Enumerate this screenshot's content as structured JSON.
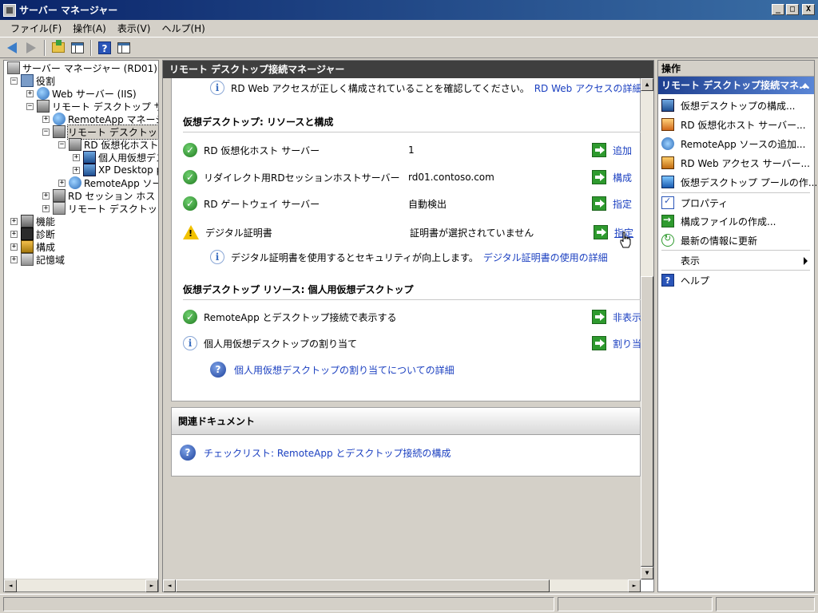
{
  "window": {
    "title": "サーバー マネージャー",
    "buttons": {
      "minimize": "_",
      "maximize": "□",
      "close": "X"
    }
  },
  "menu": [
    "ファイル(F)",
    "操作(A)",
    "表示(V)",
    "ヘルプ(H)"
  ],
  "toolbar": {
    "icons": [
      "back-arrow-icon",
      "forward-arrow-icon",
      "up-folder-icon",
      "show-hide-console-tree-icon",
      "help-icon",
      "show-hide-action-pane-icon"
    ],
    "help_label": "?"
  },
  "tree": {
    "root": "サーバー マネージャー (RD01)",
    "roles": "役割",
    "web_server": "Web サーバー (IIS)",
    "rds": "リモート デスクトップ サービス",
    "remoteapp_manager": "RemoteApp マネージャー",
    "rd_conn_manager": "リモート デスクトップ接続マネージャー",
    "rd_virt_host": "RD 仮想化ホスト サーバー",
    "personal_vd": "個人用仮想デスクトップ",
    "xp_desktop": "XP Desktop pool",
    "remoteapp_source": "RemoteApp ソース",
    "rd_session_host": "RD セッション ホストの構成",
    "rd_other": "リモート デスクトップ サービス",
    "features": "機能",
    "diagnostics": "診断",
    "configuration": "構成",
    "storage": "記憶域",
    "expand_symbol": "+",
    "collapse_symbol": "−"
  },
  "center": {
    "header": "リモート デスクトップ接続マネージャー",
    "top_info_text": "RD Web アクセスが正しく構成されていることを確認してください。",
    "top_info_link": "RD Web アクセスの詳細",
    "section1": {
      "title": "仮想デスクトップ: リソースと構成",
      "rows": [
        {
          "status": "ok",
          "label": "RD 仮想化ホスト サーバー",
          "value": "1",
          "action": "追加"
        },
        {
          "status": "ok",
          "label": "リダイレクト用RDセッションホストサーバー",
          "value": "rd01.contoso.com",
          "action": "構成"
        },
        {
          "status": "ok",
          "label": "RD ゲートウェイ サーバー",
          "value": "自動検出",
          "action": "指定"
        },
        {
          "status": "warn",
          "label": "デジタル証明書",
          "value": "証明書が選択されていません",
          "action": "指定"
        }
      ],
      "cert_info_text": "デジタル証明書を使用するとセキュリティが向上します。",
      "cert_info_link": "デジタル証明書の使用の詳細"
    },
    "section2": {
      "title": "仮想デスクトップ リソース: 個人用仮想デスクトップ",
      "rows": [
        {
          "status": "ok",
          "label": "RemoteApp とデスクトップ接続で表示する",
          "action": "非表示"
        },
        {
          "status": "info",
          "label": "個人用仮想デスクトップの割り当て",
          "action": "割り当て"
        }
      ],
      "help_link": "個人用仮想デスクトップの割り当てについての詳細"
    },
    "related": {
      "title": "関連ドキュメント",
      "link": "チェックリスト: RemoteApp とデスクトップ接続の構成"
    },
    "ok_symbol": "✓",
    "warn_symbol": "!",
    "info_symbol": "i",
    "help_symbol": "?"
  },
  "actions": {
    "header": "操作",
    "subheader": "リモート デスクトップ接続マネ...",
    "items": [
      {
        "label": "仮想デスクトップの構成...",
        "icon": "vm-config-icon"
      },
      {
        "label": "RD 仮想化ホスト サーバー...",
        "icon": "virt-host-icon"
      },
      {
        "label": "RemoteApp ソースの追加...",
        "icon": "remoteapp-source-icon"
      },
      {
        "label": "RD Web アクセス サーバー...",
        "icon": "web-access-icon"
      },
      {
        "label": "仮想デスクトップ プールの作...",
        "icon": "pool-create-icon"
      }
    ],
    "items2": [
      {
        "label": "プロパティ",
        "icon": "properties-icon"
      },
      {
        "label": "構成ファイルの作成...",
        "icon": "export-icon"
      },
      {
        "label": "最新の情報に更新",
        "icon": "refresh-icon"
      }
    ],
    "view": "表示",
    "help": "ヘルプ",
    "help_icon_label": "?"
  },
  "scroll": {
    "left": "◄",
    "right": "►",
    "up": "▲",
    "down": "▼"
  }
}
